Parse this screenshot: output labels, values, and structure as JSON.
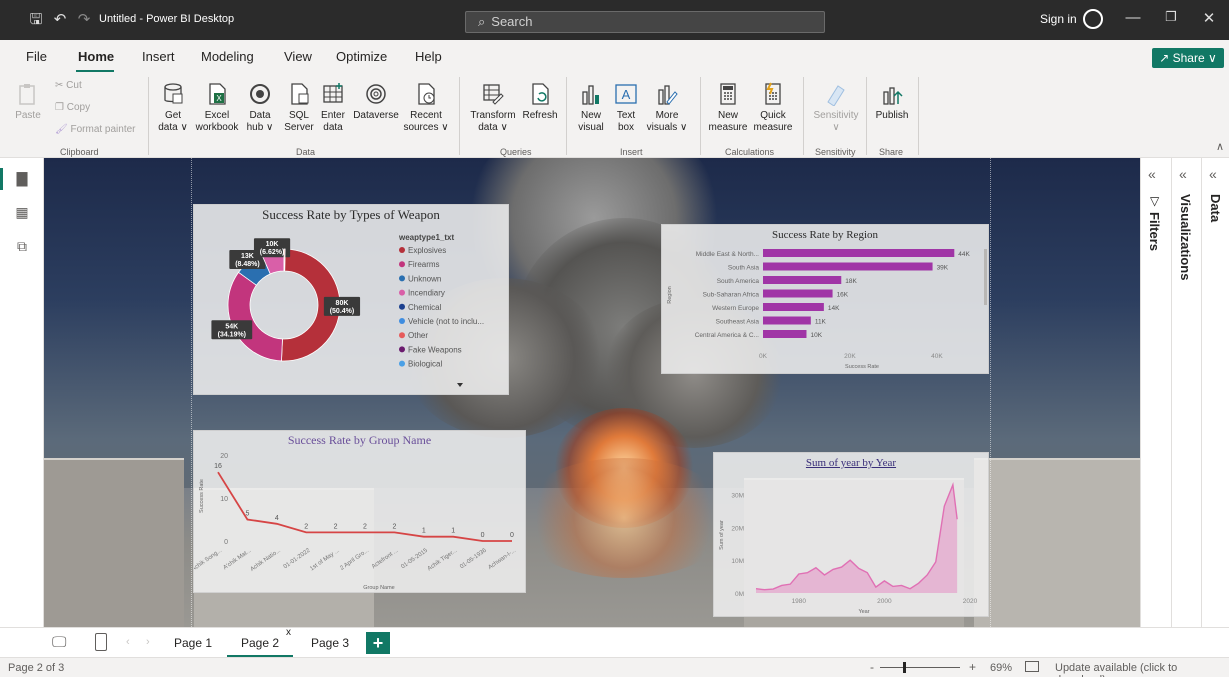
{
  "window": {
    "title": "Untitled - Power BI Desktop",
    "search_placeholder": "Search",
    "sign_in": "Sign in"
  },
  "menu": {
    "items": [
      "File",
      "Home",
      "Insert",
      "Modeling",
      "View",
      "Optimize",
      "Help"
    ],
    "active": "Home",
    "share": "Share"
  },
  "ribbon": {
    "clipboard": {
      "paste": "Paste",
      "cut": "Cut",
      "copy": "Copy",
      "format_painter": "Format painter",
      "label": "Clipboard"
    },
    "data": {
      "get_data": [
        "Get",
        "data"
      ],
      "excel": [
        "Excel",
        "workbook"
      ],
      "data_hub": [
        "Data",
        "hub"
      ],
      "sql": [
        "SQL",
        "Server"
      ],
      "enter": [
        "Enter",
        "data"
      ],
      "dataverse": [
        "Dataverse",
        ""
      ],
      "recent": [
        "Recent",
        "sources"
      ],
      "label": "Data"
    },
    "queries": {
      "transform": [
        "Transform",
        "data"
      ],
      "refresh": [
        "Refresh",
        ""
      ],
      "label": "Queries"
    },
    "insert": {
      "new_visual": [
        "New",
        "visual"
      ],
      "text_box": [
        "Text",
        "box"
      ],
      "more_visuals": [
        "More",
        "visuals"
      ],
      "label": "Insert"
    },
    "calculations": {
      "new_measure": [
        "New",
        "measure"
      ],
      "quick_measure": [
        "Quick",
        "measure"
      ],
      "label": "Calculations"
    },
    "sensitivity": {
      "button": [
        "Sensitivity",
        ""
      ],
      "label": "Sensitivity"
    },
    "share": {
      "publish": [
        "Publish",
        ""
      ],
      "label": "Share"
    }
  },
  "panes": {
    "filters": "Filters",
    "visualizations": "Visualizations",
    "data": "Data"
  },
  "pages": {
    "tabs": [
      "Page 1",
      "Page 2",
      "Page 3"
    ],
    "active": "Page 2",
    "close": "x",
    "add": "+"
  },
  "status": {
    "page_indicator": "Page 2 of 3",
    "zoom": "69%",
    "zoom_minus": "-",
    "zoom_plus": "+",
    "update": "Update available (click to download)"
  },
  "colors": {
    "accent": "#117865",
    "titlebar": "#2b2b2b",
    "bar": "#a035a6",
    "line_red": "#d64545",
    "area_pink": "#e38fc4"
  },
  "chart_data": [
    {
      "type": "pie",
      "title": "Success Rate by Types of Weapon",
      "legend_title": "weaptype1_txt",
      "legend": [
        {
          "name": "Explosives",
          "color": "#b5303a"
        },
        {
          "name": "Firearms",
          "color": "#c2357d"
        },
        {
          "name": "Unknown",
          "color": "#2a6fb0"
        },
        {
          "name": "Incendiary",
          "color": "#d95fa8"
        },
        {
          "name": "Chemical",
          "color": "#1b3f8e"
        },
        {
          "name": "Vehicle (not to inclu...",
          "color": "#3f8de0"
        },
        {
          "name": "Other",
          "color": "#e65b5b"
        },
        {
          "name": "Fake Weapons",
          "color": "#6a1b6e"
        },
        {
          "name": "Biological",
          "color": "#4aa0e6"
        }
      ],
      "slices": [
        {
          "name": "Explosives",
          "value": 50.4,
          "label": "80K\n(50.4%)",
          "color": "#b5303a"
        },
        {
          "name": "Firearms",
          "value": 34.19,
          "label": "54K\n(34.19%)",
          "color": "#c2357d"
        },
        {
          "name": "Unknown",
          "value": 8.48,
          "label": "13K\n(8.48%)",
          "color": "#2a6fb0"
        },
        {
          "name": "Incendiary",
          "value": 6.62,
          "label": "10K\n(6.62%)",
          "color": "#d95fa8"
        },
        {
          "name": "Other",
          "value": 0.31,
          "label": "",
          "color": "#e65b5b"
        }
      ],
      "legend_position": "right"
    },
    {
      "type": "bar",
      "orientation": "horizontal",
      "title": "Success Rate by Region",
      "categories": [
        "Middle East & North...",
        "South Asia",
        "South America",
        "Sub-Saharan Africa",
        "Western Europe",
        "Southeast Asia",
        "Central America & C..."
      ],
      "values": [
        44,
        39,
        18,
        16,
        14,
        11,
        10
      ],
      "data_labels": [
        "44K",
        "39K",
        "18K",
        "16K",
        "14K",
        "11K",
        "10K"
      ],
      "xlabel": "Success Rate",
      "ylabel": "Region",
      "xticks": [
        "0K",
        "20K",
        "40K"
      ],
      "xlim": [
        0,
        46
      ]
    },
    {
      "type": "line",
      "title": "Success Rate by Group Name",
      "categories": [
        "Achik Song...",
        "A'chik Mat...",
        "Achik Natio...",
        "01-01-2022",
        "1st of May ...",
        "2 April Gro...",
        "Actefront ...",
        "01-05-2015",
        "Achik Tiger...",
        "01-05-1936",
        "Achwan-I-..."
      ],
      "values": [
        16,
        5,
        4,
        2,
        2,
        2,
        2,
        1,
        1,
        0,
        0
      ],
      "data_labels": [
        "16",
        "5",
        "4",
        "2",
        "2",
        "2",
        "2",
        "1",
        "1",
        "0",
        "0"
      ],
      "xlabel": "Group Name",
      "ylabel": "Success Rate",
      "yticks": [
        "0",
        "10",
        "20"
      ],
      "ylim": [
        0,
        20
      ]
    },
    {
      "type": "area",
      "title": "Sum of year by Year",
      "x": [
        1970,
        1972,
        1974,
        1976,
        1978,
        1980,
        1982,
        1984,
        1986,
        1988,
        1990,
        1992,
        1994,
        1996,
        1998,
        2000,
        2002,
        2004,
        2006,
        2008,
        2010,
        2012,
        2014,
        2016,
        2017
      ],
      "values": [
        1.3,
        1.0,
        1.2,
        2.3,
        2.7,
        5.8,
        6.2,
        7.7,
        5.5,
        7.2,
        7.9,
        10.0,
        7.5,
        6.2,
        1.8,
        3.7,
        2.0,
        2.3,
        1.3,
        3.0,
        5.5,
        9.5,
        26.5,
        33.0,
        22.5
      ],
      "xlabel": "Year",
      "ylabel": "Sum of year",
      "yticks": [
        "0M",
        "10M",
        "20M",
        "30M"
      ],
      "xticks": [
        "1980",
        "2000",
        "2020"
      ],
      "ylim": [
        0,
        36
      ],
      "xlim": [
        1970,
        2020
      ]
    }
  ]
}
